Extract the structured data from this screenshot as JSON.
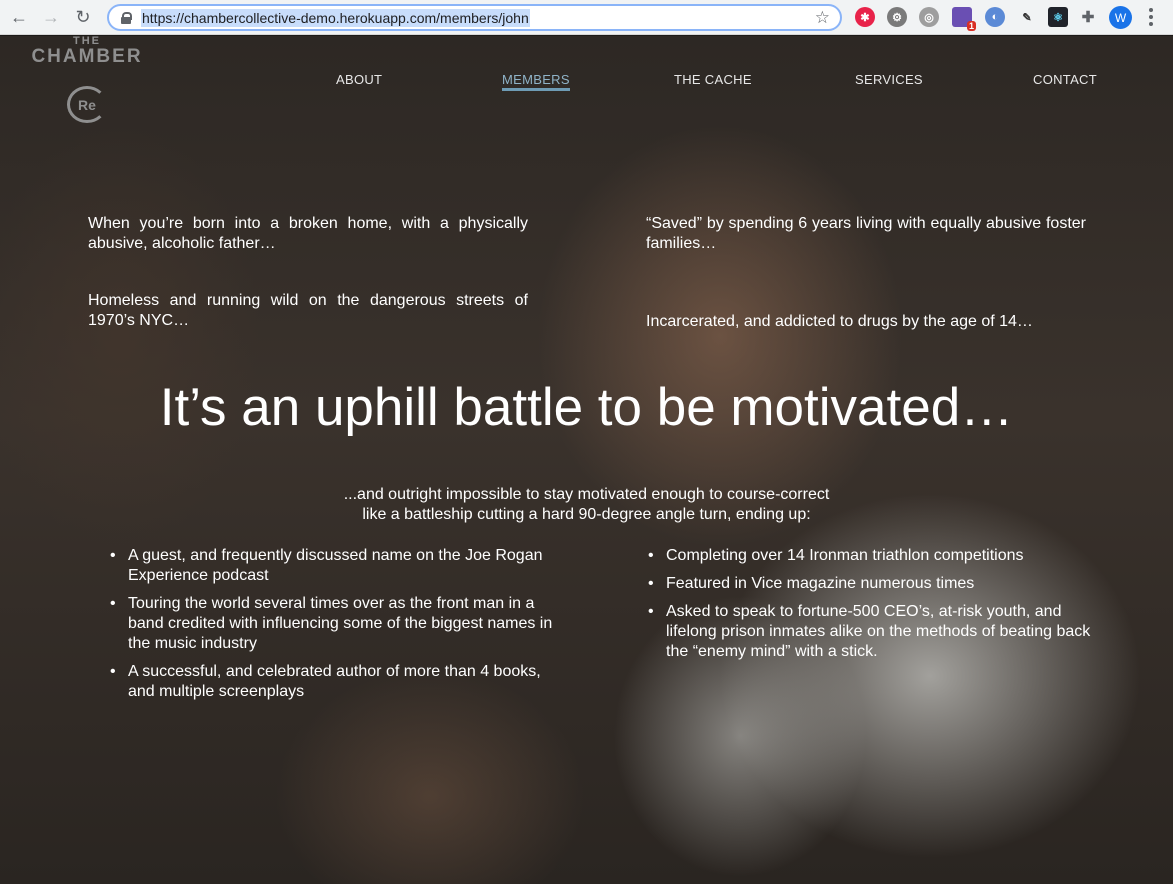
{
  "browser": {
    "url": "https://chambercollective-demo.herokuapp.com/members/john",
    "profile_initial": "W",
    "extension_badge": "1"
  },
  "logo": {
    "the": "THE",
    "chamber": "CHAMBER",
    "mark": "Re"
  },
  "nav": {
    "items": [
      "ABOUT",
      "MEMBERS",
      "THE CACHE",
      "SERVICES",
      "CONTACT"
    ],
    "active": "MEMBERS"
  },
  "intro": {
    "p1": "When you’re born into a broken home, with a physically abusive, alcoholic father…",
    "p2": "“Saved” by spending 6 years living with equally abusive foster families…",
    "p3": "Homeless and running wild on the dangerous streets of 1970’s NYC…",
    "p4": "Incarcerated, and addicted to drugs by the age of 14…"
  },
  "headline": "It’s an uphill battle to be motivated…",
  "subline": {
    "line1": "...and outright impossible to stay motivated enough to course-correct",
    "line2": "like a battleship cutting a hard 90-degree angle turn, ending up:"
  },
  "achievements_left": [
    "A guest, and frequently discussed name on the Joe Rogan Experience podcast",
    "Touring the world several times over as the front man in a band credited with influencing some of the biggest names in the music industry",
    "A successful, and celebrated author of more than 4 books, and multiple screenplays"
  ],
  "achievements_right": [
    "Completing over 14 Ironman triathlon competitions",
    "Featured in Vice magazine numerous times",
    "Asked to speak to fortune-500 CEO’s, at-risk youth, and lifelong prison inmates alike on the methods of beating back the “enemy mind” with a stick."
  ]
}
